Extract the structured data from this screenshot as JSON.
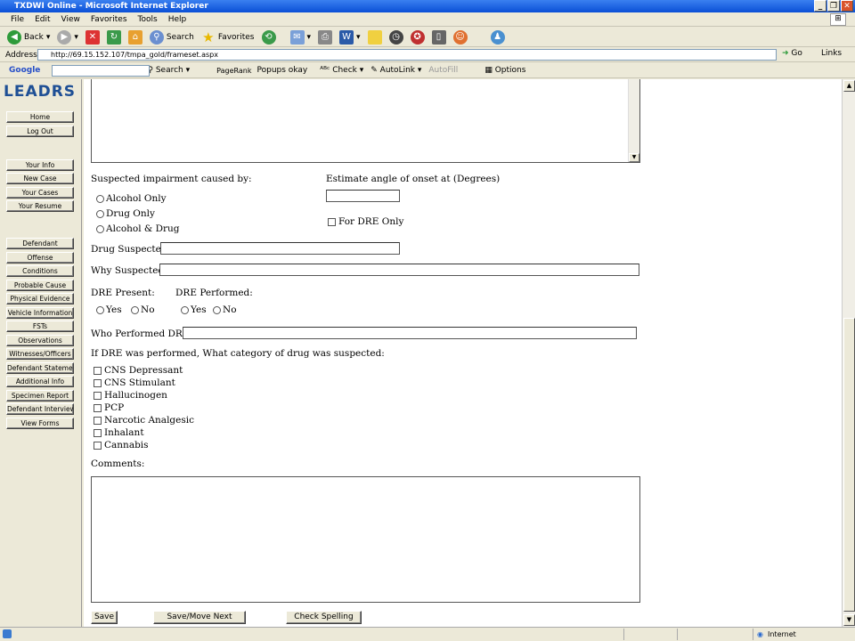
{
  "window": {
    "title": "TXDWI Online - Microsoft Internet Explorer",
    "controls": [
      "_",
      "❐",
      "✕"
    ]
  },
  "menu": [
    "File",
    "Edit",
    "View",
    "Favorites",
    "Tools",
    "Help"
  ],
  "toolbar": {
    "back": "Back",
    "search": "Search",
    "favorites": "Favorites"
  },
  "address": {
    "label": "Address",
    "url": "http://69.15.152.107/tmpa_gold/frameset.aspx",
    "go": "Go",
    "links": "Links"
  },
  "googlebar": {
    "brand": "Google",
    "search": "Search",
    "pagerank": "PageRank",
    "popups": "Popups okay",
    "check": "Check",
    "autolink": "AutoLink",
    "autofill": "AutoFill",
    "options": "Options"
  },
  "sidebar": {
    "logo": "LEADRS",
    "top": [
      "Home",
      "Log Out"
    ],
    "account": [
      "Your Info",
      "New Case",
      "Your Cases",
      "Your Resume"
    ],
    "sections": [
      "Defendant",
      "Offense",
      "Conditions",
      "Probable Cause",
      "Physical Evidence",
      "Vehicle Information",
      "FSTs",
      "Observations",
      "Witnesses/Officers",
      "Defendant Statement",
      "Additional Info",
      "Specimen Report",
      "Defendant Interview",
      "View Forms"
    ]
  },
  "form": {
    "impairment_label": "Suspected impairment caused by:",
    "impairment_options": [
      "Alcohol Only",
      "Drug Only",
      "Alcohol & Drug"
    ],
    "angle_label": "Estimate angle of onset at (Degrees)",
    "angle_value": "",
    "dre_only": "For DRE Only",
    "drug_suspected_label": "Drug Suspected:",
    "drug_suspected_value": "",
    "why_suspected_label": "Why Suspected:",
    "why_suspected_value": "",
    "dre_present_label": "DRE Present:",
    "dre_performed_label": "DRE Performed:",
    "yes": "Yes",
    "no": "No",
    "who_performed_label": "Who Performed DRE:",
    "who_performed_value": "",
    "category_label": "If DRE was performed, What category of drug was suspected:",
    "categories": [
      "CNS Depressant",
      "CNS Stimulant",
      "Hallucinogen",
      "PCP",
      "Narcotic Analgesic",
      "Inhalant",
      "Cannabis"
    ],
    "comments_label": "Comments:",
    "comments_value": "",
    "buttons": {
      "save": "Save",
      "save_next": "Save/Move Next",
      "spell": "Check Spelling"
    }
  },
  "status": {
    "zone": "Internet"
  }
}
